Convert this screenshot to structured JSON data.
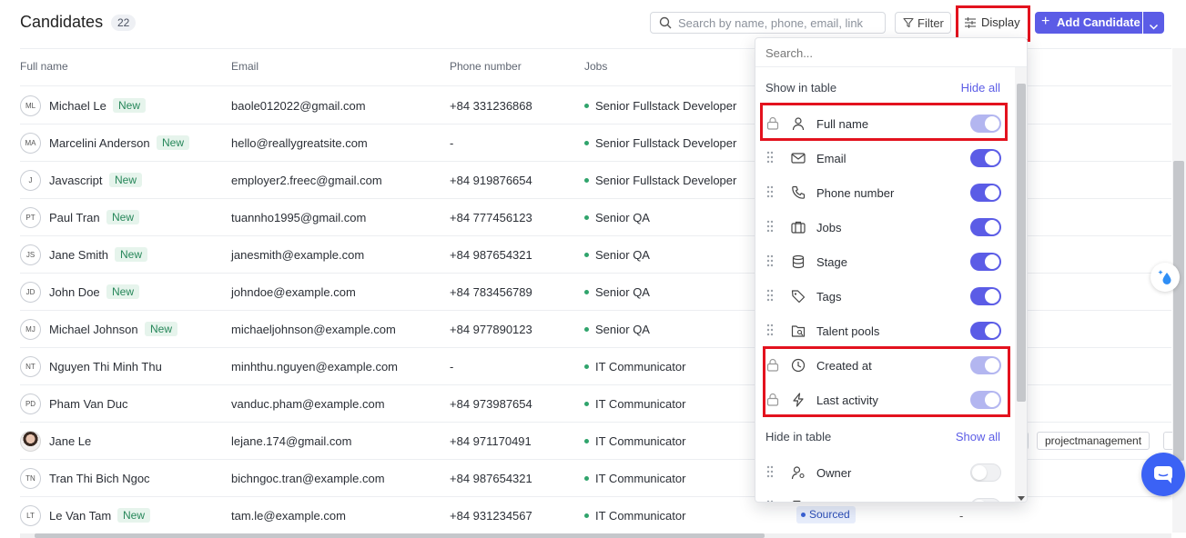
{
  "header": {
    "title": "Candidates",
    "count": "22",
    "search_placeholder": "Search by name, phone, email, link",
    "filter_label": "Filter",
    "display_label": "Display",
    "add_label": "Add Candidate"
  },
  "table": {
    "columns": [
      "Full name",
      "Email",
      "Phone number",
      "Jobs"
    ],
    "rows": [
      {
        "initials": "ML",
        "name": "Michael Le",
        "new": "New",
        "email": "baole012022@gmail.com",
        "phone": "+84 331236868",
        "job": "Senior Fullstack Developer"
      },
      {
        "initials": "MA",
        "name": "Marcelini Anderson",
        "new": "New",
        "email": "hello@reallygreatsite.com",
        "phone": "-",
        "job": "Senior Fullstack Developer"
      },
      {
        "initials": "J",
        "name": "Javascript",
        "new": "New",
        "email": "employer2.freec@gmail.com",
        "phone": "+84 919876654",
        "job": "Senior Fullstack Developer"
      },
      {
        "initials": "PT",
        "name": "Paul Tran",
        "new": "New",
        "email": "tuannho1995@gmail.com",
        "phone": "+84 777456123",
        "job": "Senior QA"
      },
      {
        "initials": "JS",
        "name": "Jane Smith",
        "new": "New",
        "email": "janesmith@example.com",
        "phone": "+84 987654321",
        "job": "Senior QA"
      },
      {
        "initials": "JD",
        "name": "John Doe",
        "new": "New",
        "email": "johndoe@example.com",
        "phone": "+84 783456789",
        "job": "Senior QA"
      },
      {
        "initials": "MJ",
        "name": "Michael Johnson",
        "new": "New",
        "email": "michaeljohnson@example.com",
        "phone": "+84 977890123",
        "job": "Senior QA"
      },
      {
        "initials": "NT",
        "name": "Nguyen Thi Minh Thu",
        "new": "",
        "email": "minhthu.nguyen@example.com",
        "phone": "-",
        "job": "IT Communicator"
      },
      {
        "initials": "PD",
        "name": "Pham Van Duc",
        "new": "",
        "email": "vanduc.pham@example.com",
        "phone": "+84 973987654",
        "job": "IT Communicator"
      },
      {
        "initials": "",
        "name": "Jane Le",
        "new": "",
        "email": "lejane.174@gmail.com",
        "phone": "+84 971170491",
        "job": "IT Communicator"
      },
      {
        "initials": "TN",
        "name": "Tran Thi Bich Ngoc",
        "new": "",
        "email": "bichngoc.tran@example.com",
        "phone": "+84 987654321",
        "job": "IT Communicator"
      },
      {
        "initials": "LT",
        "name": "Le Van Tam",
        "new": "New",
        "email": "tam.le@example.com",
        "phone": "+84 931234567",
        "job": "IT Communicator"
      }
    ],
    "tag_projectmanagement": "projectmanagement",
    "stage_sourced": "Sourced",
    "dash": "-"
  },
  "display_panel": {
    "search_placeholder": "Search...",
    "show_section": "Show in table",
    "hide_all": "Hide all",
    "hide_section": "Hide in table",
    "show_all": "Show all",
    "shown": [
      {
        "label": "Full name",
        "icon": "user-icon",
        "locked": true,
        "on": true
      },
      {
        "label": "Email",
        "icon": "mail-icon",
        "locked": false,
        "on": true
      },
      {
        "label": "Phone number",
        "icon": "phone-icon",
        "locked": false,
        "on": true
      },
      {
        "label": "Jobs",
        "icon": "briefcase-icon",
        "locked": false,
        "on": true
      },
      {
        "label": "Stage",
        "icon": "database-icon",
        "locked": false,
        "on": true
      },
      {
        "label": "Tags",
        "icon": "tag-icon",
        "locked": false,
        "on": true
      },
      {
        "label": "Talent pools",
        "icon": "folder-search-icon",
        "locked": false,
        "on": true
      },
      {
        "label": "Created at",
        "icon": "clock-icon",
        "locked": true,
        "on": true
      },
      {
        "label": "Last activity",
        "icon": "lightning-icon",
        "locked": true,
        "on": true
      }
    ],
    "hidden": [
      {
        "label": "Owner",
        "icon": "user-gear-icon",
        "locked": false,
        "on": false
      },
      {
        "label": "CV/Resume",
        "icon": "file-icon",
        "locked": false,
        "on": false
      }
    ]
  },
  "colors": {
    "accent": "#5b5ce6",
    "highlight": "#e3121e",
    "new_badge": "#27875a",
    "job_dot": "#30a46c",
    "chat": "#3b62f5"
  }
}
